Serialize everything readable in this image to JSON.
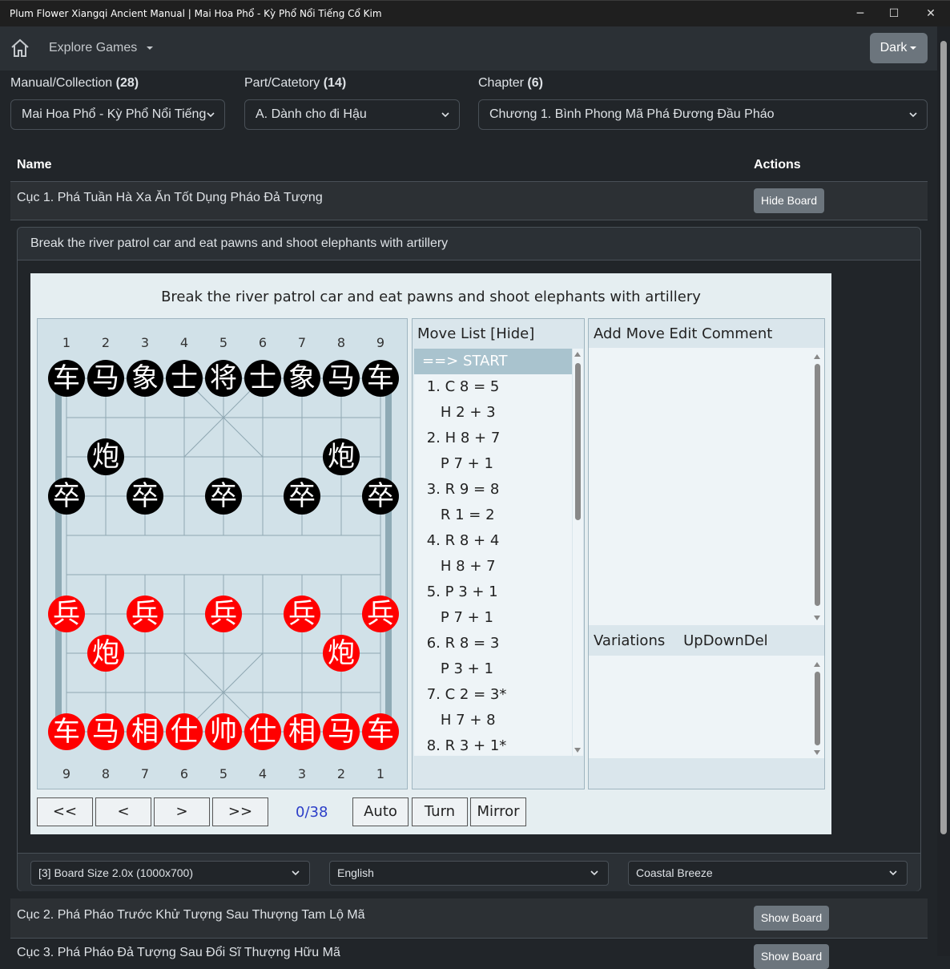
{
  "window": {
    "title": "Plum Flower Xiangqi Ancient Manual | Mai Hoa Phổ - Kỳ Phổ Nổi Tiếng Cổ Kim",
    "minimize": "─",
    "maximize": "☐",
    "close": "✕"
  },
  "nav": {
    "explore": "Explore Games",
    "theme": "Dark"
  },
  "filters": {
    "manual_label": "Manual/Collection",
    "manual_count": "(28)",
    "manual_value": "Mai Hoa Phổ - Kỳ Phổ Nổi Tiếng",
    "part_label": "Part/Catetory",
    "part_count": "(14)",
    "part_value": "A. Dành cho đi Hậu",
    "chapter_label": "Chapter",
    "chapter_count": "(6)",
    "chapter_value": "Chương 1. Bình Phong Mã Phá Đương Đầu Pháo"
  },
  "table": {
    "col_name": "Name",
    "col_actions": "Actions",
    "rows": [
      {
        "name": "Cục 1. Phá Tuần Hà Xa Ăn Tốt Dụng Pháo Đả Tượng",
        "action": "Hide Board"
      },
      {
        "name": "Cục 2. Phá Pháo Trước Khử Tượng Sau Thượng Tam Lộ Mã",
        "action": "Show Board"
      },
      {
        "name": "Cục 3. Phá Pháo Đả Tượng Sau Đổi Sĩ Thượng Hữu Mã",
        "action": "Show Board"
      }
    ]
  },
  "game": {
    "card_title": "Break the river patrol car and eat pawns and shoot elephants with artillery",
    "board_title": "Break the river patrol car and eat pawns and shoot elephants with artillery",
    "top_files": [
      "1",
      "2",
      "3",
      "4",
      "5",
      "6",
      "7",
      "8",
      "9"
    ],
    "bottom_files": [
      "9",
      "8",
      "7",
      "6",
      "5",
      "4",
      "3",
      "2",
      "1"
    ],
    "black_back": [
      "车",
      "马",
      "象",
      "士",
      "将",
      "士",
      "象",
      "马",
      "车"
    ],
    "black_cannon": "炮",
    "black_pawn": "卒",
    "red_back": [
      "车",
      "马",
      "相",
      "仕",
      "帅",
      "仕",
      "相",
      "马",
      "车"
    ],
    "red_cannon": "炮",
    "red_pawn": "兵",
    "move_list_header": "Move List [Hide]",
    "moves": [
      "==> START",
      " 1. C 8 = 5",
      "    H 2 + 3",
      " 2. H 8 + 7",
      "    P 7 + 1",
      " 3. R 9 = 8",
      "    R 1 = 2",
      " 4. R 8 + 4",
      "    H 8 + 7",
      " 5. P 3 + 1",
      "    P 7 + 1",
      " 6. R 8 = 3",
      "    P 3 + 1",
      " 7. C 2 = 3*",
      "    H 7 + 8",
      " 8. R 3 + 1*"
    ],
    "comment_header": "Add Move Edit Comment",
    "variations_header": "Variations    UpDownDel",
    "nav_first": "<<",
    "nav_prev": "<",
    "nav_next": ">",
    "nav_last": ">>",
    "counter": "0/38",
    "auto": "Auto",
    "turn": "Turn",
    "mirror": "Mirror"
  },
  "footer": {
    "board_size": "[3] Board Size 2.0x (1000x700)",
    "language": "English",
    "theme": "Coastal Breeze"
  }
}
